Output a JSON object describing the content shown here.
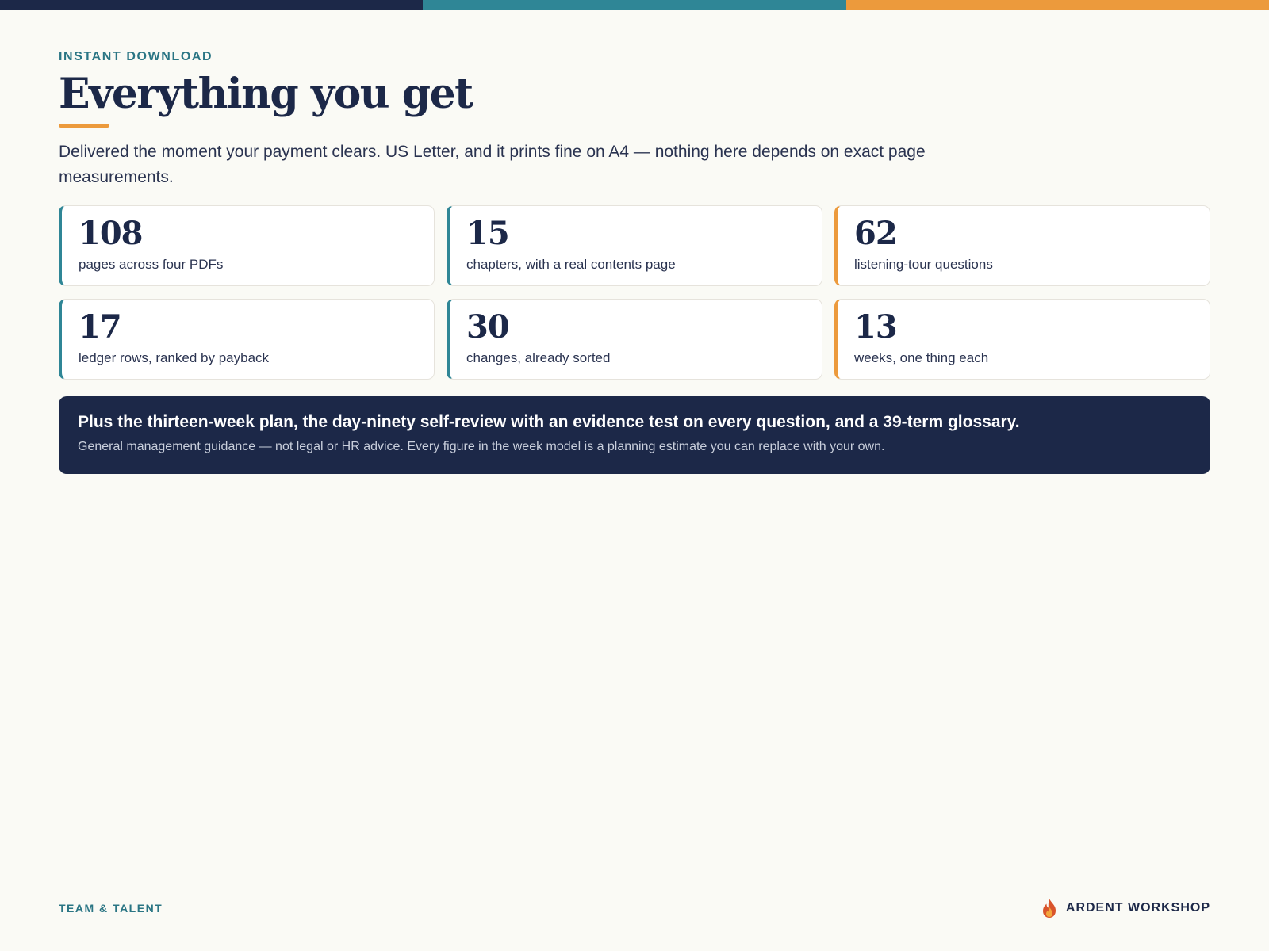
{
  "header": {
    "eyebrow": "INSTANT DOWNLOAD",
    "title": "Everything you get",
    "intro": "Delivered the moment your payment clears. US Letter, and it prints fine on A4 — nothing here depends on exact page measurements."
  },
  "stats": [
    {
      "number": "108",
      "label": "pages across four PDFs",
      "accent": "#2f8696"
    },
    {
      "number": "15",
      "label": "chapters, with a real contents page",
      "accent": "#2f8696"
    },
    {
      "number": "62",
      "label": "listening-tour questions",
      "accent": "#ec9a3c"
    },
    {
      "number": "17",
      "label": "ledger rows, ranked by payback",
      "accent": "#2f8696"
    },
    {
      "number": "30",
      "label": "changes, already sorted",
      "accent": "#2f8696"
    },
    {
      "number": "13",
      "label": "weeks, one thing each",
      "accent": "#ec9a3c"
    }
  ],
  "callout": {
    "headline": "Plus the thirteen-week plan, the day-ninety self-review with an evidence test on every question, and a 39-term glossary.",
    "note": "General management guidance — not legal or HR advice. Every figure in the week model is a planning estimate you can replace with your own."
  },
  "footer": {
    "section": "TEAM & TALENT",
    "brand_icon": "flame-logo-icon",
    "brand": "ARDENT WORKSHOP"
  },
  "colors": {
    "navy": "#1c2848",
    "teal": "#2f8696",
    "orange": "#ec9a3c",
    "background": "#fafaf5"
  }
}
